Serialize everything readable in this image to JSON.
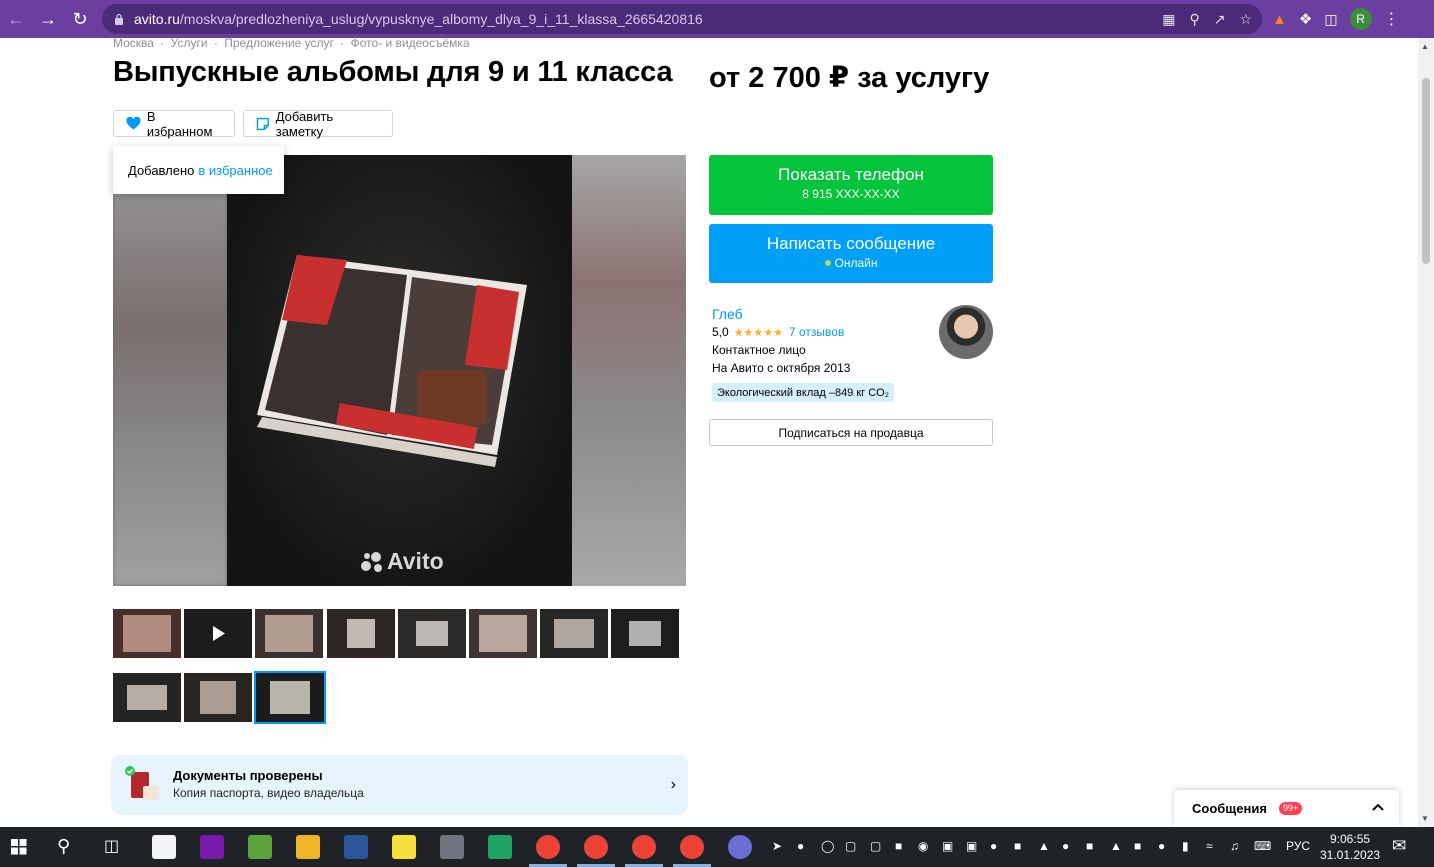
{
  "browser": {
    "url_host": "avito.ru",
    "url_path": "/moskva/predlozheniya_uslug/vypusknye_albomy_dlya_9_i_11_klassa_2665420816",
    "profile_initial": "R"
  },
  "breadcrumbs": [
    "Москва",
    "·",
    "Услуги",
    "·",
    "Предложение услуг",
    "·",
    "Фото- и видеосъёмка"
  ],
  "listing": {
    "title": "Выпускные альбомы для 9 и 11 класса",
    "price": "от 2 700 ₽ за услугу",
    "favorite_label": "В избранном",
    "note_label": "Добавить заметку",
    "tooltip_prefix": "Добавлено",
    "tooltip_link": "в избранное",
    "watermark": "Avito"
  },
  "thumbnails": {
    "count_row1": 8,
    "count_row2": 3,
    "active_index": 10
  },
  "docs_banner": {
    "title": "Документы проверены",
    "subtitle": "Копия паспорта, видео владельца"
  },
  "contact": {
    "phone_label": "Показать телефон",
    "phone_mask": "8 915 XXX-XX-XX",
    "message_label": "Написать сообщение",
    "online_label": "Онлайн"
  },
  "seller": {
    "name": "Глеб",
    "rating": "5,0",
    "stars": "★★★★★",
    "reviews": "7 отзывов",
    "role": "Контактное лицо",
    "since": "На Авито с октября 2013",
    "eco": "Экологический вклад –849 кг CO₂",
    "subscribe_label": "Подписаться на продавца"
  },
  "messages_widget": {
    "label": "Сообщения",
    "badge": "99+"
  },
  "taskbar": {
    "lang": "РУС",
    "time": "9:06:55",
    "date": "31.01.2023"
  },
  "colors": {
    "chrome": "#6b3fa0",
    "green_button": "#04c43c",
    "blue_button": "#00a0f8",
    "link": "#0099f7"
  }
}
